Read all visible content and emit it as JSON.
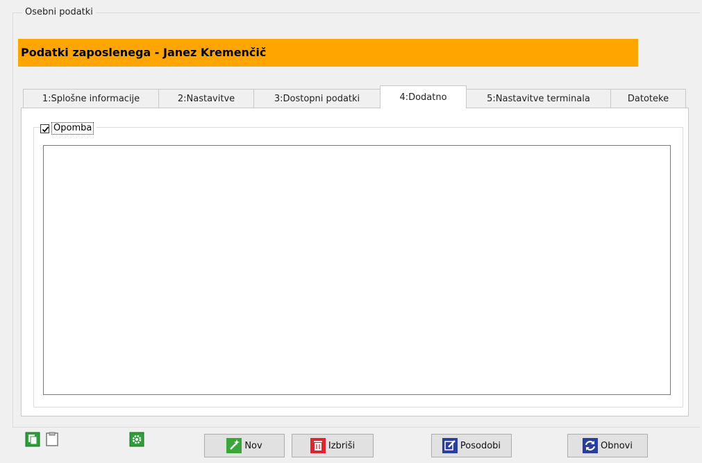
{
  "group": {
    "legend": "Osebni podatki"
  },
  "header": {
    "title": "Podatki zaposlenega - Janez Kremenčič",
    "bg_color": "#ffa500"
  },
  "tabs": [
    {
      "label": "1:Splošne informacije",
      "active": false
    },
    {
      "label": "2:Nastavitve",
      "active": false
    },
    {
      "label": "3:Dostopni podatki",
      "active": false
    },
    {
      "label": "4:Dodatno",
      "active": true
    },
    {
      "label": "5:Nastavitve terminala",
      "active": false
    },
    {
      "label": "Datoteke",
      "active": false
    }
  ],
  "note": {
    "checkbox_label": "Opomba",
    "checked": true,
    "value": ""
  },
  "toolbar": {
    "icons": [
      "copy-icon",
      "paste-icon",
      "settings-icon"
    ],
    "buttons": [
      {
        "label": "Nov",
        "icon": "new-wand-icon",
        "color": "#3aa63a"
      },
      {
        "label": "Izbriši",
        "icon": "trash-icon",
        "color": "#d9282d"
      },
      {
        "label": "Posodobi",
        "icon": "edit-icon",
        "color": "#2c3e9c"
      },
      {
        "label": "Obnovi",
        "icon": "refresh-icon",
        "color": "#2c3e9c"
      }
    ]
  }
}
